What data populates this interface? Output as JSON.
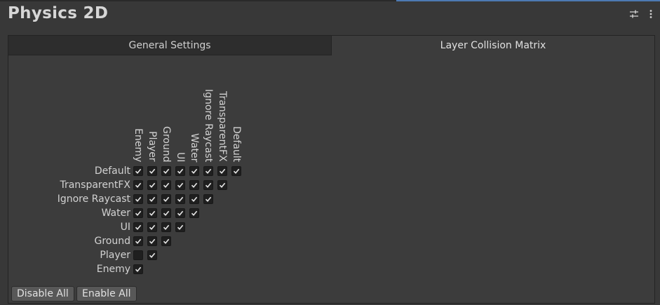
{
  "header": {
    "title": "Physics 2D",
    "icons": [
      "settings-sliders-icon",
      "more-vertical-icon"
    ]
  },
  "tabs": [
    {
      "label": "General Settings",
      "active": false
    },
    {
      "label": "Layer Collision Matrix",
      "active": true
    }
  ],
  "matrix": {
    "columns": [
      "Enemy",
      "Player",
      "Ground",
      "UI",
      "Water",
      "Ignore Raycast",
      "TransparentFX",
      "Default"
    ],
    "rows": [
      {
        "label": "Default",
        "checks": [
          true,
          true,
          true,
          true,
          true,
          true,
          true,
          true
        ]
      },
      {
        "label": "TransparentFX",
        "checks": [
          true,
          true,
          true,
          true,
          true,
          true,
          true
        ]
      },
      {
        "label": "Ignore Raycast",
        "checks": [
          true,
          true,
          true,
          true,
          true,
          true
        ]
      },
      {
        "label": "Water",
        "checks": [
          true,
          true,
          true,
          true,
          true
        ]
      },
      {
        "label": "UI",
        "checks": [
          true,
          true,
          true,
          true
        ]
      },
      {
        "label": "Ground",
        "checks": [
          true,
          true,
          true
        ]
      },
      {
        "label": "Player",
        "checks": [
          false,
          true
        ]
      },
      {
        "label": "Enemy",
        "checks": [
          true
        ]
      }
    ]
  },
  "buttons": {
    "disable_all": "Disable All",
    "enable_all": "Enable All"
  }
}
